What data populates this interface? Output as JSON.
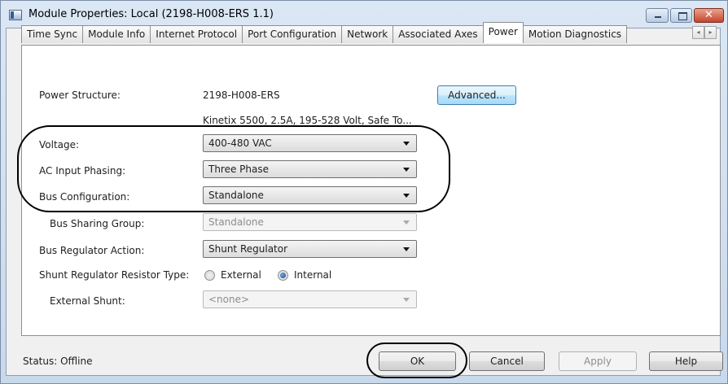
{
  "window": {
    "title": "Module Properties: Local (2198-H008-ERS 1.1)",
    "controls": [
      "minimize",
      "maximize",
      "close"
    ]
  },
  "tabs": [
    {
      "label": "Time Sync"
    },
    {
      "label": "Module Info"
    },
    {
      "label": "Internet Protocol"
    },
    {
      "label": "Port Configuration"
    },
    {
      "label": "Network"
    },
    {
      "label": "Associated Axes"
    },
    {
      "label": "Power",
      "active": true
    },
    {
      "label": "Motion Diagnostics"
    }
  ],
  "tab_scroll": {
    "left": "◂",
    "right": "▸"
  },
  "power": {
    "structure_label": "Power Structure:",
    "structure_value": "2198-H008-ERS",
    "structure_desc": "Kinetix 5500, 2.5A, 195-528 Volt, Safe To...",
    "advanced_button": "Advanced...",
    "voltage_label": "Voltage:",
    "voltage_value": "400-480 VAC",
    "phasing_label": "AC Input Phasing:",
    "phasing_value": "Three Phase",
    "bus_config_label": "Bus Configuration:",
    "bus_config_value": "Standalone",
    "bus_sharing_label": "Bus Sharing Group:",
    "bus_sharing_value": "Standalone",
    "regulator_label": "Bus Regulator Action:",
    "regulator_value": "Shunt Regulator",
    "shunt_type_label": "Shunt Regulator Resistor Type:",
    "shunt_type_options": [
      {
        "label": "External",
        "checked": false
      },
      {
        "label": "Internal",
        "checked": true
      }
    ],
    "external_shunt_label": "External Shunt:",
    "external_shunt_value": "<none>"
  },
  "footer": {
    "status": "Status:  Offline",
    "ok": "OK",
    "cancel": "Cancel",
    "apply": "Apply",
    "help": "Help"
  },
  "colors": {
    "frame": "#c9d9ec",
    "dialog_bg": "#f0f0f0",
    "panel_bg": "#ffffff",
    "advanced_button_border": "#3c7fb1",
    "annotation_ellipse": "#000000"
  }
}
